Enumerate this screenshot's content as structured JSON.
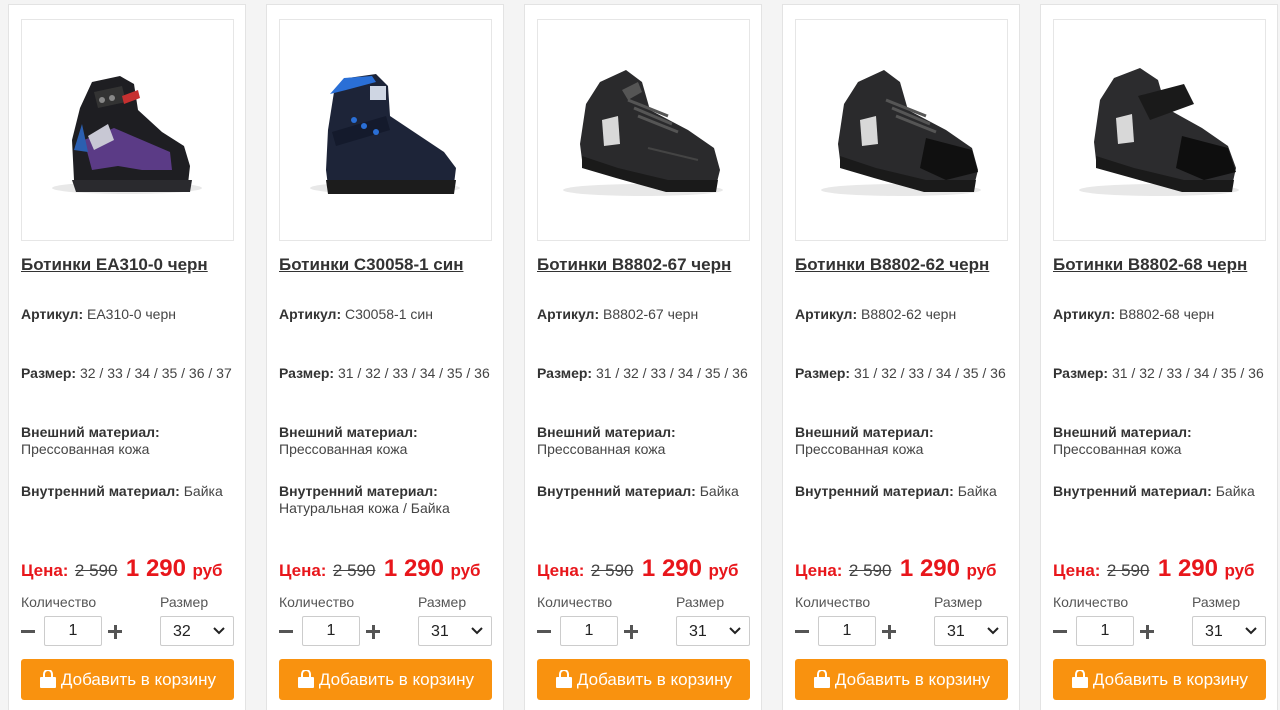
{
  "labels": {
    "article": "Артикул:",
    "size": "Размер:",
    "outer": "Внешний материал:",
    "inner": "Внутренний материал:",
    "price": "Цена:",
    "currency": "руб",
    "quantity": "Количество",
    "size_select": "Размер",
    "add_to_cart": "Добавить в корзину"
  },
  "colors": {
    "price_red": "#e8161b",
    "button_orange": "#f9920f"
  },
  "icons": {
    "minus": "minus-icon",
    "plus": "plus-icon",
    "chevron": "chevron-down-icon",
    "cart": "shopping-bag-icon"
  },
  "products": [
    {
      "title": "Ботинки EA310-0 черн",
      "image_alt": "black boot with purple panels",
      "article": "EA310-0 черн",
      "sizes": "32 / 33 / 34 / 35 / 36 / 37",
      "outer": "Прессованная кожа",
      "inner": "Байка",
      "old_price": "2 590",
      "new_price": "1 290",
      "quantity": "1",
      "selected_size": "32"
    },
    {
      "title": "Ботинки C30058-1 син",
      "image_alt": "dark blue boot with strap",
      "article": "C30058-1 син",
      "sizes": "31 / 32 / 33 / 34 / 35 / 36",
      "outer": "Прессованная кожа",
      "inner": "Натуральная кожа / Байка",
      "old_price": "2 590",
      "new_price": "1 290",
      "quantity": "1",
      "selected_size": "31"
    },
    {
      "title": "Ботинки B8802-67 черн",
      "image_alt": "black lace-up shoe",
      "article": "B8802-67 черн",
      "sizes": "31 / 32 / 33 / 34 / 35 / 36",
      "outer": "Прессованная кожа",
      "inner": "Байка",
      "old_price": "2 590",
      "new_price": "1 290",
      "quantity": "1",
      "selected_size": "31"
    },
    {
      "title": "Ботинки B8802-62 черн",
      "image_alt": "black lace-up shoe with suede toe",
      "article": "B8802-62 черн",
      "sizes": "31 / 32 / 33 / 34 / 35 / 36",
      "outer": "Прессованная кожа",
      "inner": "Байка",
      "old_price": "2 590",
      "new_price": "1 290",
      "quantity": "1",
      "selected_size": "31"
    },
    {
      "title": "Ботинки B8802-68 черн",
      "image_alt": "black shoe with strap and suede toe",
      "article": "B8802-68 черн",
      "sizes": "31 / 32 / 33 / 34 / 35 / 36",
      "outer": "Прессованная кожа",
      "inner": "Байка",
      "old_price": "2 590",
      "new_price": "1 290",
      "quantity": "1",
      "selected_size": "31"
    }
  ]
}
